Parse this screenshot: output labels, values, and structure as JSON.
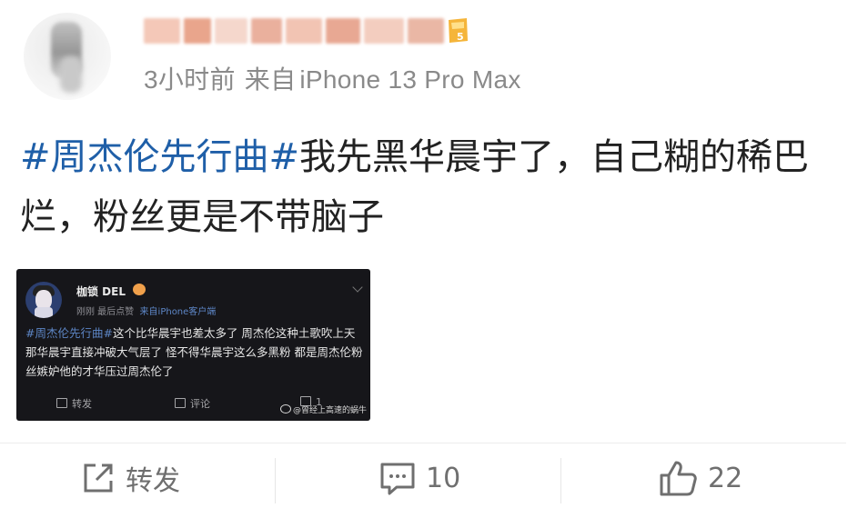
{
  "post": {
    "meta": [
      "3小时前",
      "来自",
      "iPhone 13 Pro Max"
    ],
    "text": {
      "hashtag": "#周杰伦先行曲#",
      "body": "我先黑华晨宇了，自己糊的稀巴烂，粉丝更是不带脑子"
    }
  },
  "embedded_screenshot": {
    "username": "枷锁 DEL",
    "subline_time": "刚刚 最后点赞",
    "subline_source": "来自iPhone客户端",
    "hashtag": "#周杰伦先行曲#",
    "body": "这个比华晨宇也差太多了 周杰伦这种土歌吹上天 那华晨宇直接冲破大气层了 怪不得华晨宇这么多黑粉 都是周杰伦粉丝嫉妒他的才华压过周杰伦了",
    "actions": {
      "repost": "转发",
      "comment": "评论",
      "like_count": "1"
    },
    "watermark": "@曾经上高速的蜗牛"
  },
  "actions": {
    "repost_label": "转发",
    "comment_count": "10",
    "like_count": "22"
  },
  "colors": {
    "hashtag": "#1f5fa8",
    "text": "#222222",
    "meta": "#8a8a8a",
    "action": "#6f6f6f",
    "screenshot_bg": "#16161a"
  }
}
